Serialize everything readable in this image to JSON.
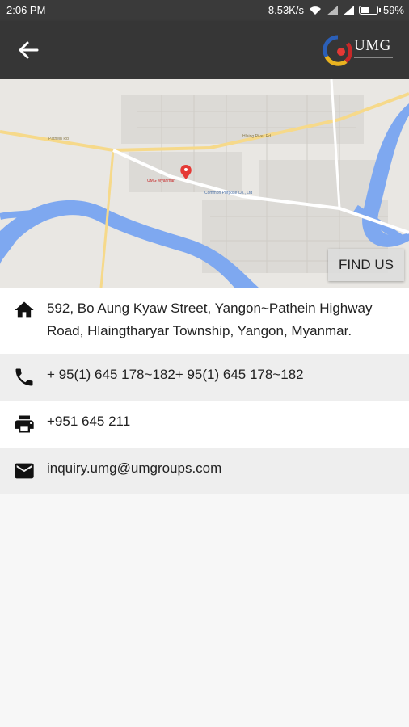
{
  "status_bar": {
    "time": "2:06 PM",
    "speed": "8.53K/s",
    "battery": "59%",
    "battery_level": 0.59
  },
  "app_bar": {
    "logo_text": "UMG"
  },
  "map": {
    "pin_label": "UMG Myanmar",
    "place_label": "Common Purpose Co., Ltd",
    "road_label_1": "Hlaing River Rd",
    "road_label_2": "Pathein Rd",
    "find_button": "FIND US"
  },
  "contacts": [
    {
      "icon": "home-icon",
      "text": "592, Bo Aung Kyaw Street, Yangon~Pathein Highway Road, Hlaingtharyar Township, Yangon, Myanmar."
    },
    {
      "icon": "phone-icon",
      "text": "+ 95(1) 645 178~182+ 95(1) 645 178~182"
    },
    {
      "icon": "printer-icon",
      "text": "+951 645 211"
    },
    {
      "icon": "mail-icon",
      "text": "inquiry.umg@umgroups.com"
    }
  ],
  "colors": {
    "app_bar": "#363636",
    "status_bar": "#3a3a3a",
    "river": "#7ea8f0",
    "pin": "#e53935"
  }
}
